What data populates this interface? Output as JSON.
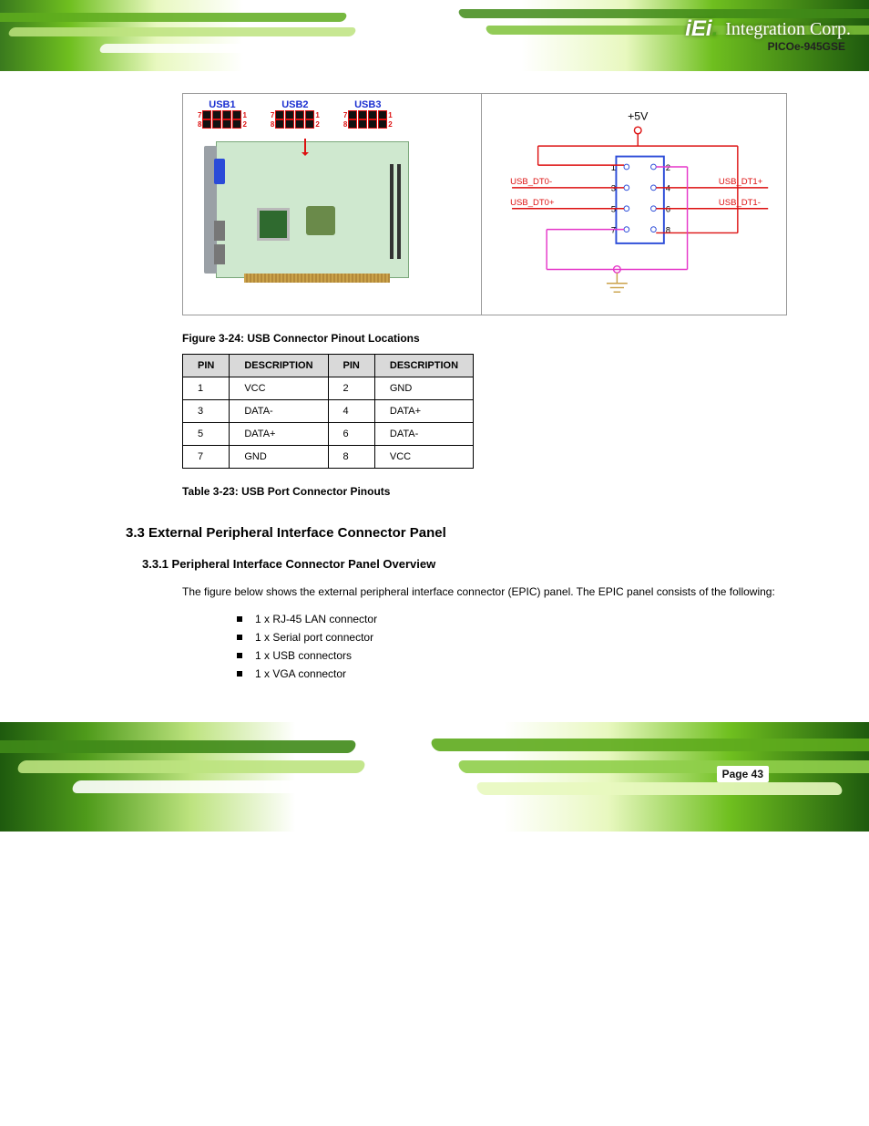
{
  "header": {
    "brand_logo_text": "iEi",
    "brand_suffix": "Integration Corp.",
    "product_line": "PICOe-945GSE"
  },
  "figure": {
    "left": {
      "conn_labels": [
        "USB1",
        "USB2",
        "USB3"
      ],
      "pin_tl": "7",
      "pin_tr": "1",
      "pin_bl": "8",
      "pin_br": "2"
    },
    "right": {
      "vcc": "+5V",
      "left_sig_top": "USB_DT0-",
      "left_sig_bot": "USB_DT0+",
      "right_sig_top": "USB_DT1+",
      "right_sig_bot": "USB_DT1-",
      "pins": [
        "1",
        "2",
        "3",
        "4",
        "5",
        "6",
        "7",
        "8"
      ]
    },
    "caption": "Figure 3-24: USB Connector Pinout Locations"
  },
  "pin_table": {
    "headers": [
      "PIN",
      "DESCRIPTION",
      "PIN",
      "DESCRIPTION"
    ],
    "rows": [
      [
        "1",
        "VCC",
        "2",
        "GND"
      ],
      [
        "3",
        "DATA-",
        "4",
        "DATA+"
      ],
      [
        "5",
        "DATA+",
        "6",
        "DATA-"
      ],
      [
        "7",
        "GND",
        "8",
        "VCC"
      ]
    ],
    "caption": "Table 3-23: USB Port Connector Pinouts"
  },
  "section": {
    "num_title": "3.3 External Peripheral Interface Connector Panel",
    "sub_num_title": "3.3.1 Peripheral Interface Connector Panel Overview",
    "intro": "The figure below shows the external peripheral interface connector (EPIC) panel. The EPIC panel consists of the following:",
    "bullets": [
      "1 x RJ-45 LAN connector",
      "1 x Serial port connector",
      "1 x USB connectors",
      "1 x VGA connector"
    ]
  },
  "footer": {
    "page_label": "Page 43"
  }
}
